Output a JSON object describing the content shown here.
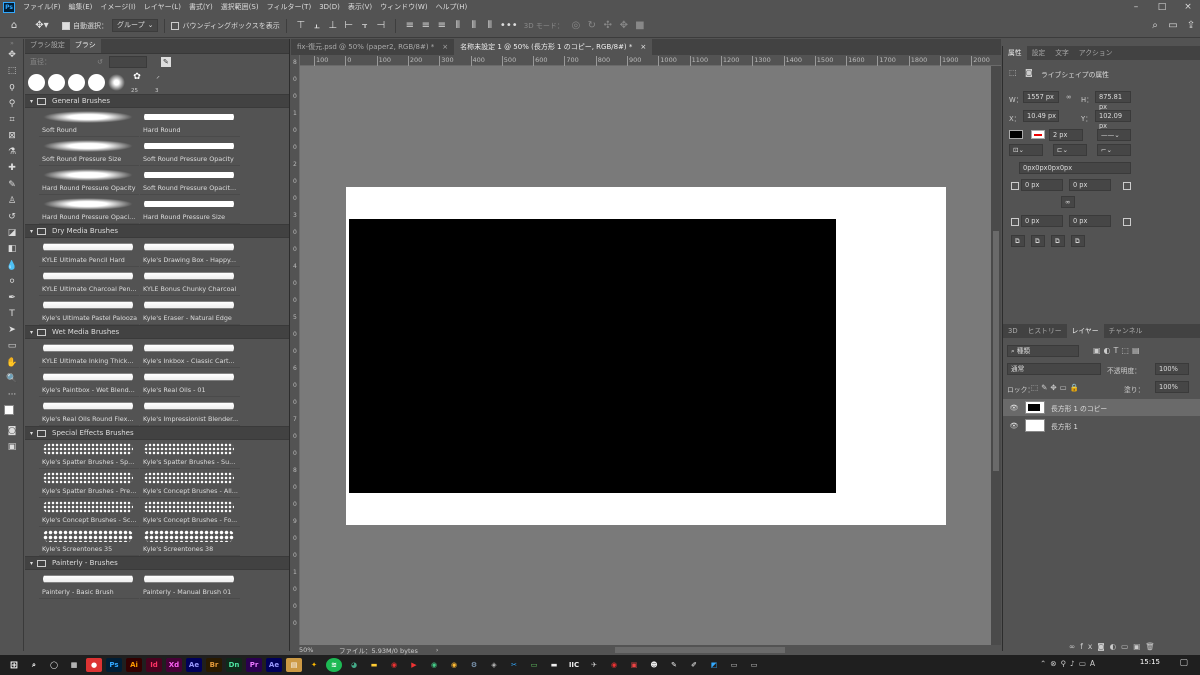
{
  "menubar": {
    "logo": "Ps",
    "items": [
      "ファイル(F)",
      "編集(E)",
      "イメージ(I)",
      "レイヤー(L)",
      "書式(Y)",
      "選択範囲(S)",
      "フィルター(T)",
      "3D(D)",
      "表示(V)",
      "ウィンドウ(W)",
      "ヘルプ(H)"
    ]
  },
  "options": {
    "auto_select_label": "自動選択：",
    "auto_select_mode": "グループ",
    "bounding_box_label": "バウンディングボックスを表示",
    "mode_3d_label": "3D モード：",
    "more": "•••"
  },
  "brush_panel": {
    "tabs": [
      "ブラシ設定",
      "ブラシ"
    ],
    "angle_label": "直径：",
    "presets": [
      "",
      "",
      "",
      "",
      "",
      "25",
      "3"
    ],
    "groups": [
      {
        "name": "General Brushes",
        "brushes": [
          "Soft Round",
          "Hard Round",
          "Soft Round Pressure Size",
          "Soft Round Pressure Opacity",
          "Hard Round Pressure Opacity",
          "Soft Round Pressure Opacit...",
          "Hard Round Pressure Opaci...",
          "Hard Round Pressure Size"
        ]
      },
      {
        "name": "Dry Media Brushes",
        "brushes": [
          "KYLE Ultimate Pencil Hard",
          "Kyle's Drawing Box - Happy...",
          "KYLE Ultimate Charcoal Pen...",
          "KYLE Bonus Chunky Charcoal",
          "Kyle's Ultimate Pastel Palooza",
          "Kyle's Eraser - Natural Edge"
        ]
      },
      {
        "name": "Wet Media Brushes",
        "brushes": [
          "KYLE Ultimate Inking Thick...",
          "Kyle's Inkbox - Classic Cart...",
          "Kyle's Paintbox - Wet Blend...",
          "Kyle's Real Oils - 01",
          "Kyle's Real Oils Round Flex...",
          "Kyle's Impressionist Blender..."
        ]
      },
      {
        "name": "Special Effects Brushes",
        "brushes": [
          "Kyle's Spatter Brushes - Sp...",
          "Kyle's Spatter Brushes - Su...",
          "Kyle's Spatter Brushes - Pre...",
          "Kyle's Concept Brushes - All...",
          "Kyle's Concept Brushes - Sc...",
          "Kyle's Concept Brushes - Fo...",
          "Kyle's Screentones 35",
          "Kyle's Screentones 38"
        ]
      },
      {
        "name": "Painterly - Brushes",
        "brushes": [
          "Painterly - Basic Brush",
          "Painterly - Manual Brush 01"
        ]
      }
    ]
  },
  "documents": {
    "tabs": [
      {
        "title": "fix-復元.psd @ 50% (paper2, RGB/8#) *",
        "close": "×",
        "active": false
      },
      {
        "title": "名称未設定 1 @ 50% (長方形 1 のコピー, RGB/8#) *",
        "close": "×",
        "active": true
      }
    ]
  },
  "ruler": {
    "h_ticks": [
      "100",
      "0",
      "100",
      "200",
      "300",
      "400",
      "500",
      "600",
      "700",
      "800",
      "900",
      "1000",
      "1100",
      "1200",
      "1300",
      "1400",
      "1500",
      "1600",
      "1700",
      "1800",
      "1900",
      "2000"
    ],
    "v_ticks": [
      "8",
      "0",
      "0",
      "1",
      "0",
      "0",
      "2",
      "0",
      "0",
      "3",
      "0",
      "0",
      "4",
      "0",
      "0",
      "5",
      "0",
      "0",
      "6",
      "0",
      "0",
      "7",
      "0",
      "0",
      "8",
      "0",
      "0",
      "9",
      "0",
      "0",
      "1",
      "0",
      "0",
      "0"
    ]
  },
  "status": {
    "zoom": "50%",
    "file_info": "ファイル：5.93M/0 bytes"
  },
  "properties_panel": {
    "tabs": [
      "属性",
      "設定",
      "文字",
      "アクション"
    ],
    "title": "ライブシェイプの属性",
    "w_label": "W：",
    "w_value": "1557 px",
    "h_label": "H：",
    "h_value": "875.81 px",
    "x_label": "X：",
    "x_value": "10.49 px",
    "y_label": "Y：",
    "y_value": "102.09 px",
    "stroke_width": "2 px",
    "corner_values": "0px0px0px0px",
    "r1": "0 px",
    "r2": "0 px",
    "r3": "0 px",
    "r4": "0 px"
  },
  "layers_panel": {
    "tabs": [
      "3D",
      "ヒストリー",
      "レイヤー",
      "チャンネル"
    ],
    "filter_label": "種類",
    "blend_mode": "通常",
    "opacity_label": "不透明度：",
    "opacity_value": "100%",
    "lock_label": "ロック：",
    "fill_label": "塗り：",
    "fill_value": "100%",
    "layers": [
      {
        "name": "長方形 1 のコピー",
        "selected": true
      },
      {
        "name": "長方形 1",
        "selected": false
      }
    ]
  },
  "taskbar": {
    "clock": "15:15",
    "apps": [
      "Ps",
      "Ai",
      "Id",
      "Xd",
      "Ae",
      "Br",
      "Dn",
      "Pr",
      "Ae"
    ]
  }
}
